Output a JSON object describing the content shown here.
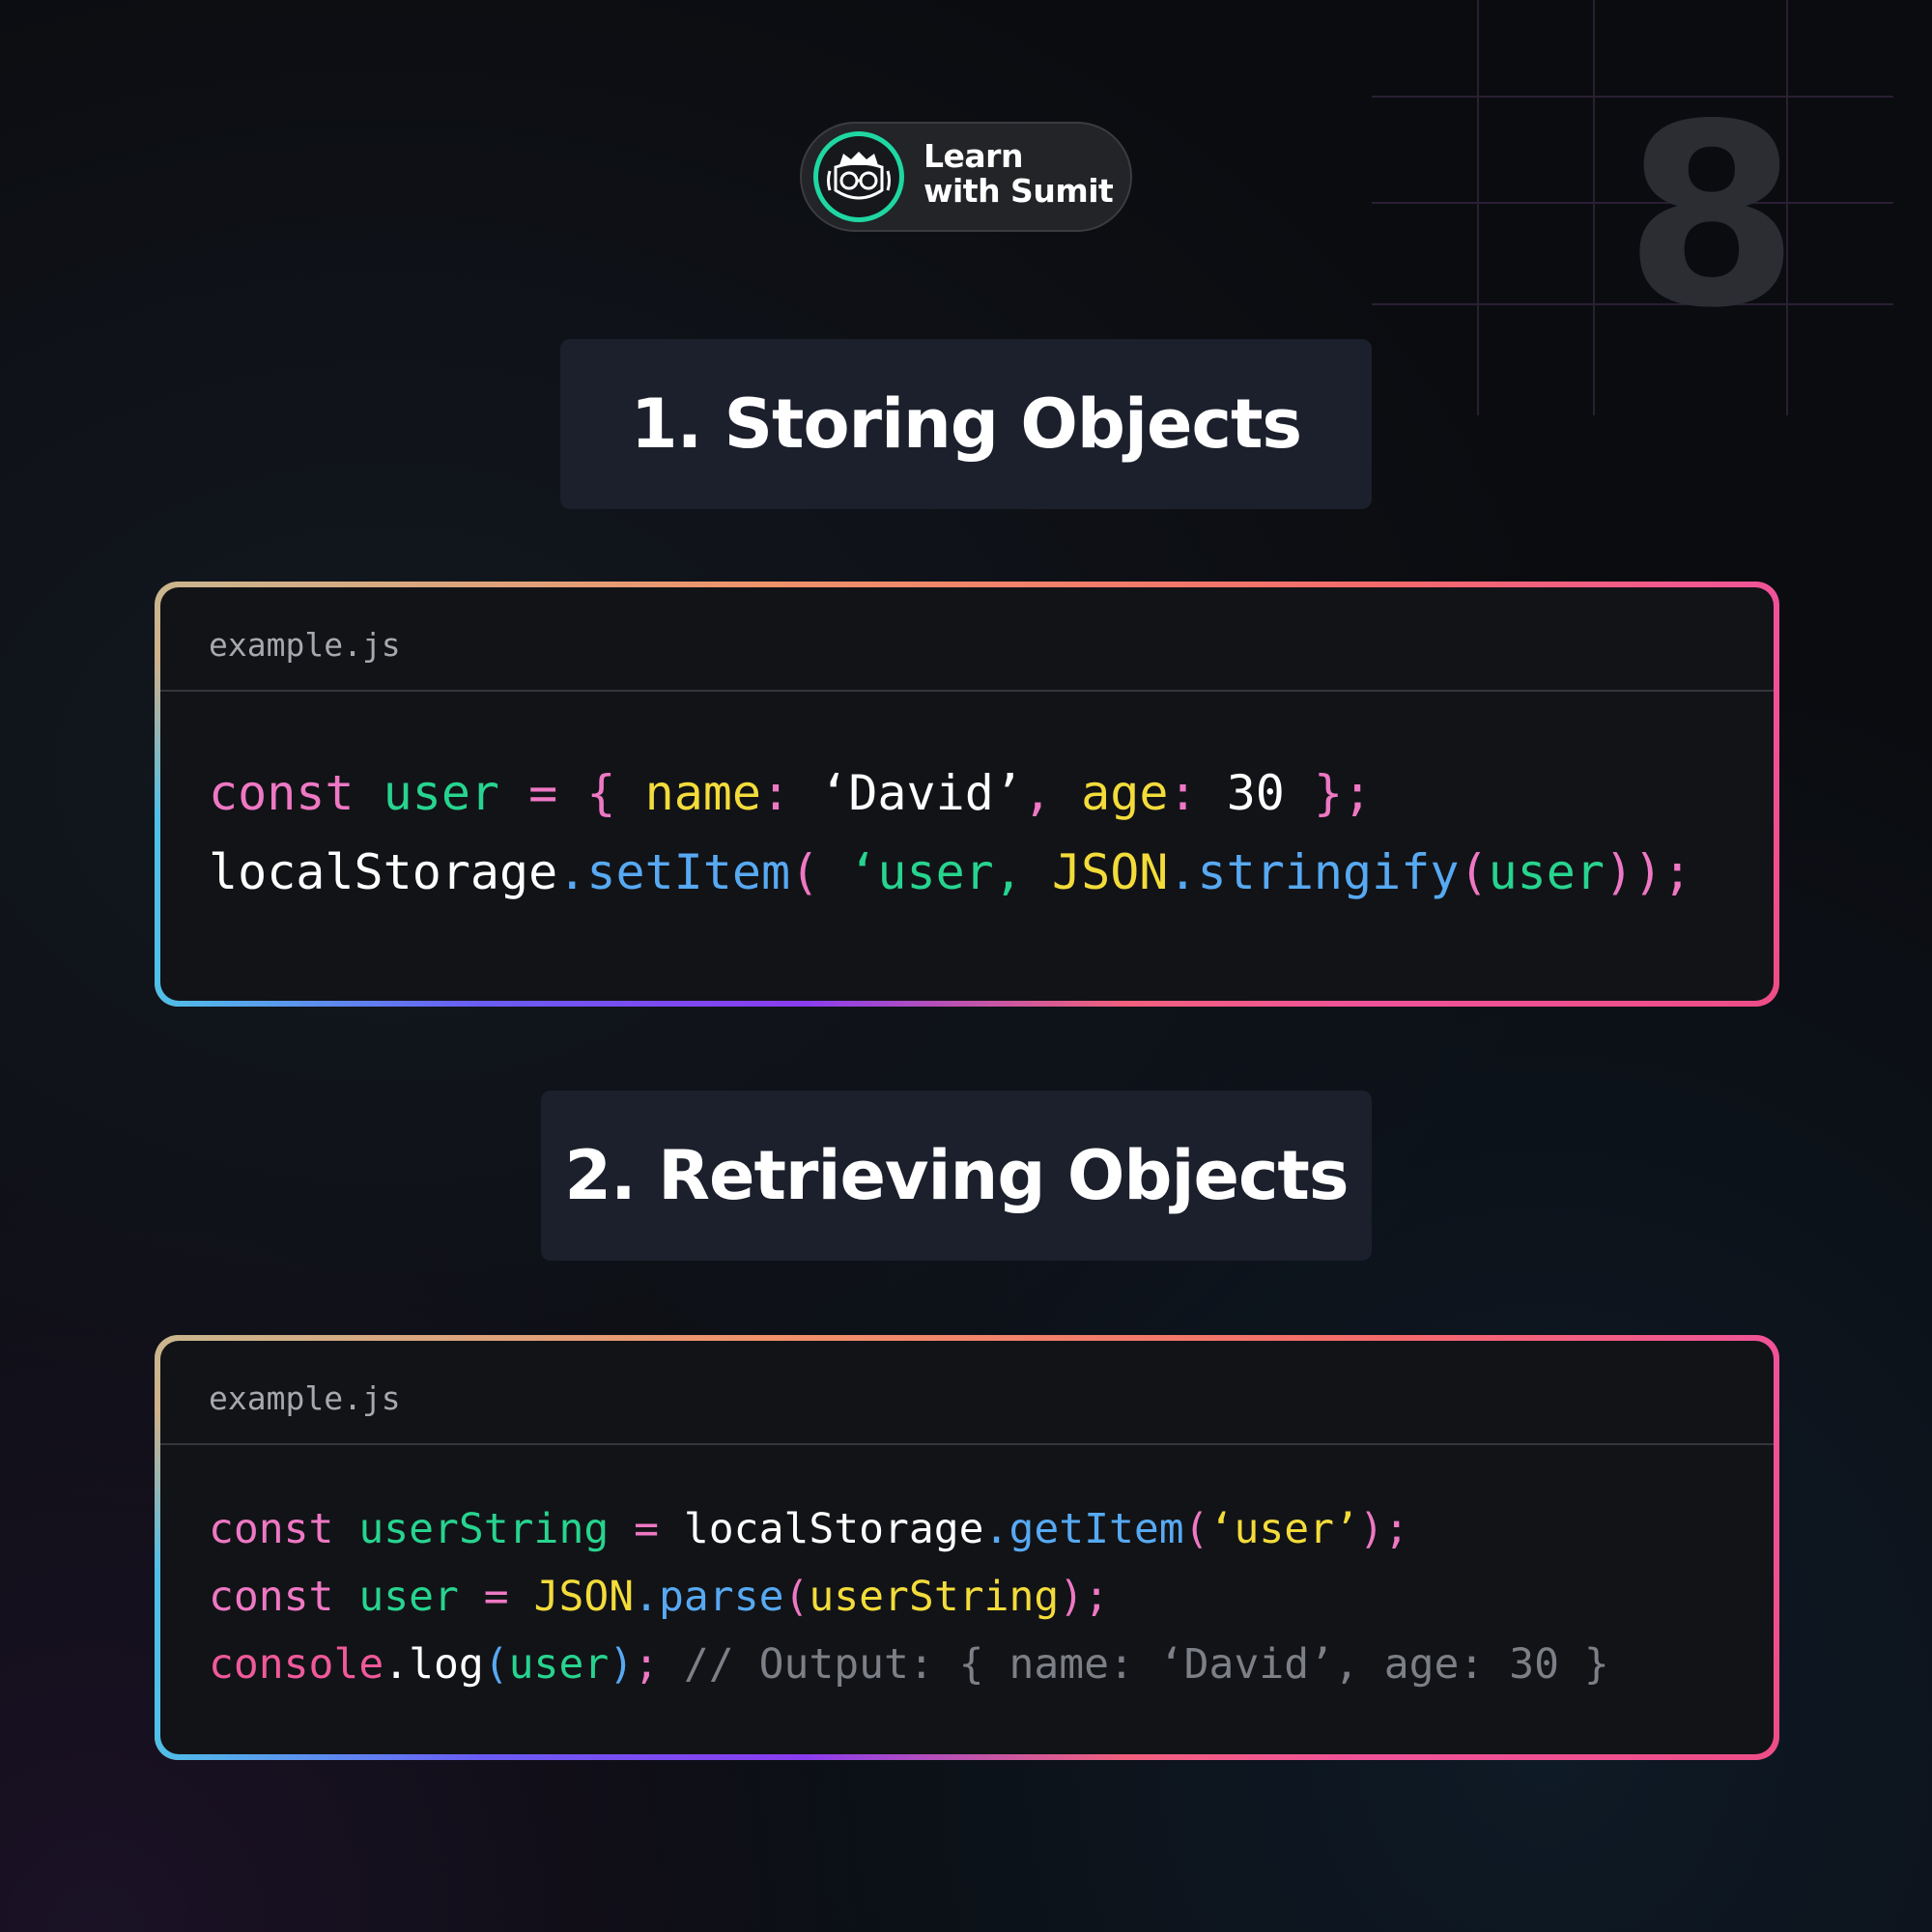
{
  "slide_number": "8",
  "brand": {
    "line1": "Learn",
    "line2": "with Sumit",
    "accent_color": "#1fd7a2",
    "logo_icon": "developer-face-with-glasses-icon"
  },
  "sections": [
    {
      "heading": "1. Storing Objects",
      "file_name": "example.js",
      "lines": [
        [
          {
            "t": "const",
            "c": "kw"
          },
          {
            "t": " ",
            "c": "def"
          },
          {
            "t": "user",
            "c": "var"
          },
          {
            "t": " ",
            "c": "def"
          },
          {
            "t": "=",
            "c": "kw"
          },
          {
            "t": " ",
            "c": "def"
          },
          {
            "t": "{",
            "c": "br1"
          },
          {
            "t": " ",
            "c": "def"
          },
          {
            "t": "name",
            "c": "key"
          },
          {
            "t": ":",
            "c": "kw"
          },
          {
            "t": " ‘David’",
            "c": "def"
          },
          {
            "t": ",",
            "c": "kw"
          },
          {
            "t": " ",
            "c": "def"
          },
          {
            "t": "age",
            "c": "key"
          },
          {
            "t": ":",
            "c": "kw"
          },
          {
            "t": " 30 ",
            "c": "def"
          },
          {
            "t": "}",
            "c": "br1"
          },
          {
            "t": ";",
            "c": "kw"
          }
        ],
        [
          {
            "t": "localStorage",
            "c": "def"
          },
          {
            "t": ".setItem",
            "c": "fn"
          },
          {
            "t": "(",
            "c": "br1"
          },
          {
            "t": " ‘user,",
            "c": "str2"
          },
          {
            "t": " ",
            "c": "def"
          },
          {
            "t": "JSON",
            "c": "key"
          },
          {
            "t": ".stringify",
            "c": "fn"
          },
          {
            "t": "(",
            "c": "br1"
          },
          {
            "t": "user",
            "c": "var"
          },
          {
            "t": "))",
            "c": "br1"
          },
          {
            "t": ";",
            "c": "kw"
          }
        ]
      ]
    },
    {
      "heading": "2. Retrieving Objects",
      "file_name": "example.js",
      "lines": [
        [
          {
            "t": "const",
            "c": "kw"
          },
          {
            "t": " ",
            "c": "def"
          },
          {
            "t": "userString",
            "c": "var"
          },
          {
            "t": " ",
            "c": "def"
          },
          {
            "t": "=",
            "c": "kw"
          },
          {
            "t": " localStorage",
            "c": "def"
          },
          {
            "t": ".getItem",
            "c": "fn"
          },
          {
            "t": "(",
            "c": "br1"
          },
          {
            "t": "‘user’",
            "c": "str"
          },
          {
            "t": ")",
            "c": "br1"
          },
          {
            "t": ";",
            "c": "kw"
          }
        ],
        [
          {
            "t": "const",
            "c": "kw"
          },
          {
            "t": " ",
            "c": "def"
          },
          {
            "t": "user",
            "c": "var"
          },
          {
            "t": " ",
            "c": "def"
          },
          {
            "t": "=",
            "c": "kw"
          },
          {
            "t": " ",
            "c": "def"
          },
          {
            "t": "JSON",
            "c": "key"
          },
          {
            "t": ".parse",
            "c": "fn"
          },
          {
            "t": "(",
            "c": "br1"
          },
          {
            "t": "userString",
            "c": "str"
          },
          {
            "t": ")",
            "c": "br1"
          },
          {
            "t": ";",
            "c": "kw"
          }
        ],
        [
          {
            "t": "console",
            "c": "log"
          },
          {
            "t": ".log",
            "c": "def"
          },
          {
            "t": "(",
            "c": "br2"
          },
          {
            "t": "user",
            "c": "var"
          },
          {
            "t": ")",
            "c": "br2"
          },
          {
            "t": ";",
            "c": "kw"
          },
          {
            "t": " // Output: { name: ‘David’, age: 30 }",
            "c": "cm"
          }
        ]
      ]
    }
  ]
}
